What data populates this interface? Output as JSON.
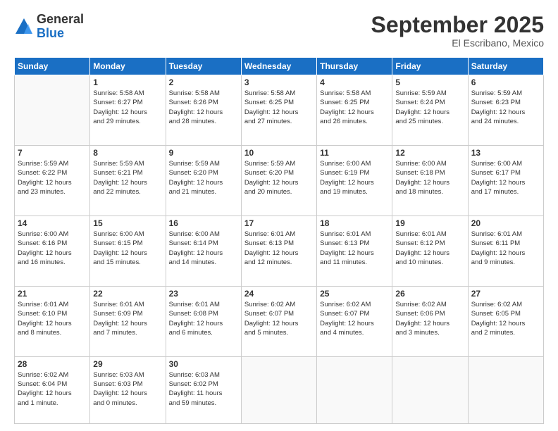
{
  "logo": {
    "general": "General",
    "blue": "Blue"
  },
  "title": "September 2025",
  "subtitle": "El Escribano, Mexico",
  "days_header": [
    "Sunday",
    "Monday",
    "Tuesday",
    "Wednesday",
    "Thursday",
    "Friday",
    "Saturday"
  ],
  "weeks": [
    [
      {
        "num": "",
        "info": ""
      },
      {
        "num": "1",
        "info": "Sunrise: 5:58 AM\nSunset: 6:27 PM\nDaylight: 12 hours\nand 29 minutes."
      },
      {
        "num": "2",
        "info": "Sunrise: 5:58 AM\nSunset: 6:26 PM\nDaylight: 12 hours\nand 28 minutes."
      },
      {
        "num": "3",
        "info": "Sunrise: 5:58 AM\nSunset: 6:25 PM\nDaylight: 12 hours\nand 27 minutes."
      },
      {
        "num": "4",
        "info": "Sunrise: 5:58 AM\nSunset: 6:25 PM\nDaylight: 12 hours\nand 26 minutes."
      },
      {
        "num": "5",
        "info": "Sunrise: 5:59 AM\nSunset: 6:24 PM\nDaylight: 12 hours\nand 25 minutes."
      },
      {
        "num": "6",
        "info": "Sunrise: 5:59 AM\nSunset: 6:23 PM\nDaylight: 12 hours\nand 24 minutes."
      }
    ],
    [
      {
        "num": "7",
        "info": "Sunrise: 5:59 AM\nSunset: 6:22 PM\nDaylight: 12 hours\nand 23 minutes."
      },
      {
        "num": "8",
        "info": "Sunrise: 5:59 AM\nSunset: 6:21 PM\nDaylight: 12 hours\nand 22 minutes."
      },
      {
        "num": "9",
        "info": "Sunrise: 5:59 AM\nSunset: 6:20 PM\nDaylight: 12 hours\nand 21 minutes."
      },
      {
        "num": "10",
        "info": "Sunrise: 5:59 AM\nSunset: 6:20 PM\nDaylight: 12 hours\nand 20 minutes."
      },
      {
        "num": "11",
        "info": "Sunrise: 6:00 AM\nSunset: 6:19 PM\nDaylight: 12 hours\nand 19 minutes."
      },
      {
        "num": "12",
        "info": "Sunrise: 6:00 AM\nSunset: 6:18 PM\nDaylight: 12 hours\nand 18 minutes."
      },
      {
        "num": "13",
        "info": "Sunrise: 6:00 AM\nSunset: 6:17 PM\nDaylight: 12 hours\nand 17 minutes."
      }
    ],
    [
      {
        "num": "14",
        "info": "Sunrise: 6:00 AM\nSunset: 6:16 PM\nDaylight: 12 hours\nand 16 minutes."
      },
      {
        "num": "15",
        "info": "Sunrise: 6:00 AM\nSunset: 6:15 PM\nDaylight: 12 hours\nand 15 minutes."
      },
      {
        "num": "16",
        "info": "Sunrise: 6:00 AM\nSunset: 6:14 PM\nDaylight: 12 hours\nand 14 minutes."
      },
      {
        "num": "17",
        "info": "Sunrise: 6:01 AM\nSunset: 6:13 PM\nDaylight: 12 hours\nand 12 minutes."
      },
      {
        "num": "18",
        "info": "Sunrise: 6:01 AM\nSunset: 6:13 PM\nDaylight: 12 hours\nand 11 minutes."
      },
      {
        "num": "19",
        "info": "Sunrise: 6:01 AM\nSunset: 6:12 PM\nDaylight: 12 hours\nand 10 minutes."
      },
      {
        "num": "20",
        "info": "Sunrise: 6:01 AM\nSunset: 6:11 PM\nDaylight: 12 hours\nand 9 minutes."
      }
    ],
    [
      {
        "num": "21",
        "info": "Sunrise: 6:01 AM\nSunset: 6:10 PM\nDaylight: 12 hours\nand 8 minutes."
      },
      {
        "num": "22",
        "info": "Sunrise: 6:01 AM\nSunset: 6:09 PM\nDaylight: 12 hours\nand 7 minutes."
      },
      {
        "num": "23",
        "info": "Sunrise: 6:01 AM\nSunset: 6:08 PM\nDaylight: 12 hours\nand 6 minutes."
      },
      {
        "num": "24",
        "info": "Sunrise: 6:02 AM\nSunset: 6:07 PM\nDaylight: 12 hours\nand 5 minutes."
      },
      {
        "num": "25",
        "info": "Sunrise: 6:02 AM\nSunset: 6:07 PM\nDaylight: 12 hours\nand 4 minutes."
      },
      {
        "num": "26",
        "info": "Sunrise: 6:02 AM\nSunset: 6:06 PM\nDaylight: 12 hours\nand 3 minutes."
      },
      {
        "num": "27",
        "info": "Sunrise: 6:02 AM\nSunset: 6:05 PM\nDaylight: 12 hours\nand 2 minutes."
      }
    ],
    [
      {
        "num": "28",
        "info": "Sunrise: 6:02 AM\nSunset: 6:04 PM\nDaylight: 12 hours\nand 1 minute."
      },
      {
        "num": "29",
        "info": "Sunrise: 6:03 AM\nSunset: 6:03 PM\nDaylight: 12 hours\nand 0 minutes."
      },
      {
        "num": "30",
        "info": "Sunrise: 6:03 AM\nSunset: 6:02 PM\nDaylight: 11 hours\nand 59 minutes."
      },
      {
        "num": "",
        "info": ""
      },
      {
        "num": "",
        "info": ""
      },
      {
        "num": "",
        "info": ""
      },
      {
        "num": "",
        "info": ""
      }
    ]
  ]
}
